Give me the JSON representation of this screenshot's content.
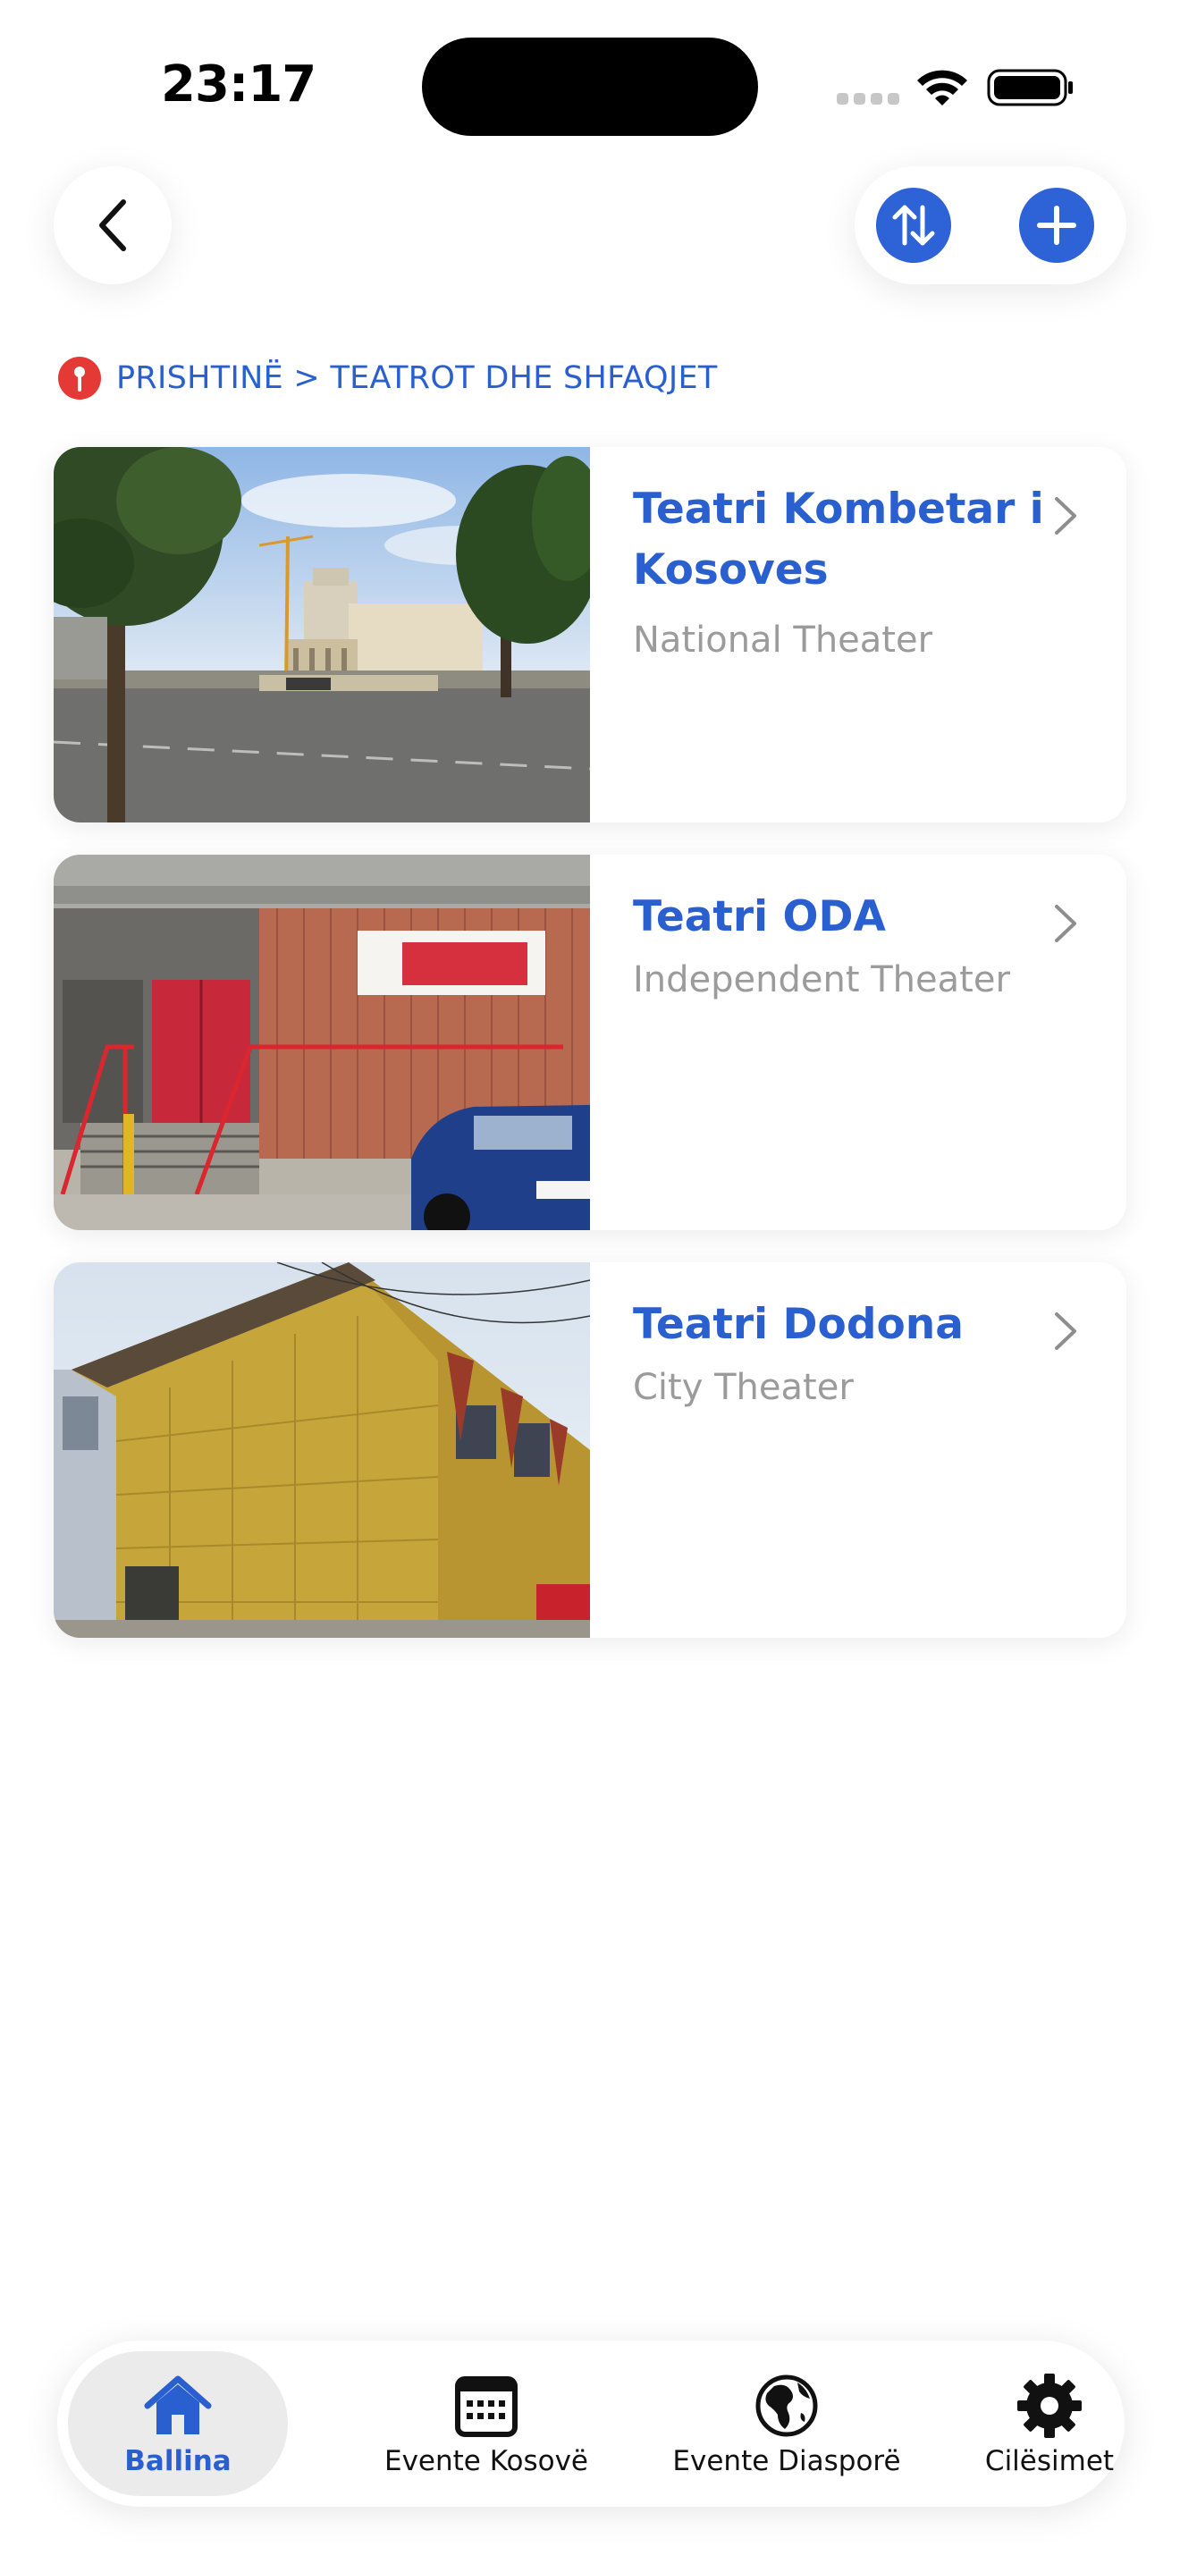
{
  "status_bar": {
    "time": "23:17"
  },
  "colors": {
    "accent": "#2d63d6",
    "title_blue": "#2a5fcf",
    "subtitle_gray": "#9b9b9b",
    "pin_red": "#e53935",
    "tab_active_bg": "#ebebeb"
  },
  "header": {
    "back_icon": "chevron-left-icon",
    "sort_icon": "arrows-up-down-icon",
    "add_icon": "plus-icon"
  },
  "breadcrumb": {
    "icon": "location-pin-icon",
    "text": "PRISHTINË > TEATROT DHE SHFAQJET"
  },
  "venues": [
    {
      "title": "Teatri Kombetar i Kosoves",
      "subtitle": "National Theater",
      "photo": "photo of national theater building"
    },
    {
      "title": "Teatri ODA",
      "subtitle": "Independent Theater",
      "photo": "photo of ODA theater entrance"
    },
    {
      "title": "Teatri Dodona",
      "subtitle": "City Theater",
      "photo": "photo of yellow Dodona theater building"
    }
  ],
  "tab_bar": {
    "items": [
      {
        "label": "Ballina",
        "icon": "home-icon",
        "active": true
      },
      {
        "label": "Evente Kosovë",
        "icon": "calendar-icon",
        "active": false
      },
      {
        "label": "Evente Diasporë",
        "icon": "globe-icon",
        "active": false
      },
      {
        "label": "Cilësimet",
        "icon": "gear-icon",
        "active": false
      }
    ]
  }
}
